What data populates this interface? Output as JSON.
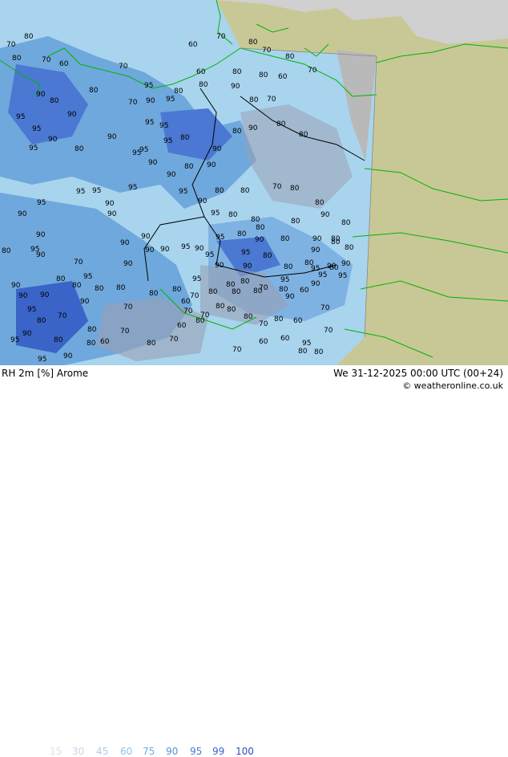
{
  "footer": {
    "title": "RH 2m [%] Arome",
    "datetime": "We 31-12-2025 00:00 UTC (00+24)",
    "credit": "© weatheronline.co.uk"
  },
  "legend": [
    {
      "value": "15",
      "color": "#d8e2f0"
    },
    {
      "value": "30",
      "color": "#c6d6ec"
    },
    {
      "value": "45",
      "color": "#b4c8e8"
    },
    {
      "value": "60",
      "color": "#8ec2ec"
    },
    {
      "value": "75",
      "color": "#6fa8dc"
    },
    {
      "value": "90",
      "color": "#5b8fd6"
    },
    {
      "value": "95",
      "color": "#4a78d2"
    },
    {
      "value": "99",
      "color": "#3a64c8"
    },
    {
      "value": "100",
      "color": "#2d50b8"
    }
  ],
  "colors": {
    "land_outside": "#c8c896",
    "sea": "#d0d0d0",
    "coast": "#00b400",
    "borders": "#000000"
  },
  "contour_labels": [
    "80",
    "70",
    "80",
    "70",
    "60",
    "70",
    "60",
    "70",
    "80",
    "70",
    "80",
    "70",
    "60",
    "80",
    "80",
    "95",
    "90",
    "80",
    "90",
    "80",
    "95",
    "70",
    "90",
    "95",
    "80",
    "90",
    "80",
    "80",
    "70",
    "60",
    "95",
    "95",
    "90",
    "80",
    "90",
    "95",
    "95",
    "80",
    "90",
    "80",
    "90",
    "80",
    "80",
    "95",
    "95",
    "90",
    "95",
    "90",
    "90",
    "80",
    "90",
    "80",
    "80",
    "70",
    "80",
    "80",
    "90",
    "95",
    "95",
    "95",
    "95",
    "90",
    "95",
    "90",
    "80",
    "80",
    "80",
    "90",
    "80",
    "70",
    "80",
    "95",
    "95",
    "90",
    "90",
    "95",
    "95",
    "80",
    "80",
    "80",
    "90",
    "80",
    "90",
    "80",
    "95",
    "90",
    "90",
    "90",
    "80",
    "80",
    "80",
    "80",
    "90",
    "90",
    "90",
    "90",
    "90",
    "95",
    "95",
    "90",
    "90",
    "80",
    "95",
    "90",
    "80",
    "80",
    "95",
    "80",
    "80",
    "80",
    "95",
    "95",
    "90",
    "90",
    "80",
    "90",
    "90",
    "80",
    "70",
    "80",
    "80",
    "70",
    "80",
    "80",
    "70",
    "80",
    "90",
    "90",
    "95",
    "95",
    "90",
    "80",
    "70",
    "80",
    "60",
    "70",
    "60",
    "70",
    "80",
    "80",
    "60",
    "70",
    "80",
    "95",
    "80",
    "70",
    "80",
    "80",
    "60",
    "70",
    "70",
    "60",
    "80",
    "95",
    "90",
    "80",
    "70",
    "60",
    "80",
    "70",
    "60",
    "95",
    "80"
  ]
}
